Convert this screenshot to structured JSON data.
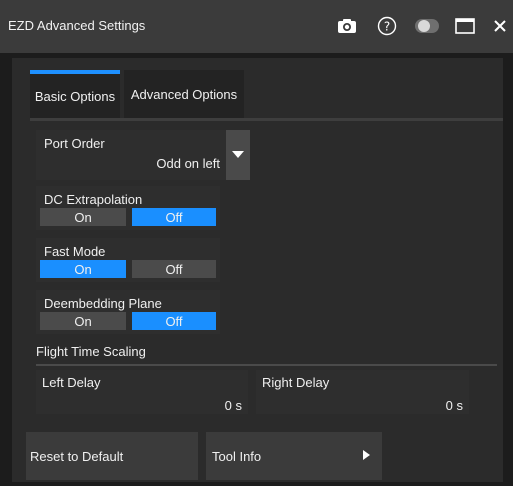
{
  "window": {
    "title": "EZD Advanced Settings",
    "icons": [
      "camera-icon",
      "help-icon",
      "toggle-icon",
      "maximize-icon",
      "close-icon"
    ]
  },
  "tabs": [
    {
      "label": "Basic Options",
      "active": true
    },
    {
      "label": "Advanced Options",
      "active": false
    }
  ],
  "port_order": {
    "label": "Port Order",
    "value": "Odd on left"
  },
  "dc_extrapolation": {
    "label": "DC Extrapolation",
    "on_label": "On",
    "off_label": "Off",
    "selected": "Off"
  },
  "fast_mode": {
    "label": "Fast Mode",
    "on_label": "On",
    "off_label": "Off",
    "selected": "On"
  },
  "deembedding_plane": {
    "label": "Deembedding Plane",
    "on_label": "On",
    "off_label": "Off",
    "selected": "Off"
  },
  "flight_time_scaling": {
    "label": "Flight Time Scaling",
    "left_delay": {
      "label": "Left Delay",
      "value": "0 s"
    },
    "right_delay": {
      "label": "Right Delay",
      "value": "0 s"
    }
  },
  "buttons": {
    "reset": "Reset to Default",
    "tool_info": "Tool Info"
  },
  "colors": {
    "accent": "#1a8fff",
    "titlebar": "#3b3b3b",
    "panel": "#2b2b2b",
    "tile": "#2e2e2e"
  }
}
